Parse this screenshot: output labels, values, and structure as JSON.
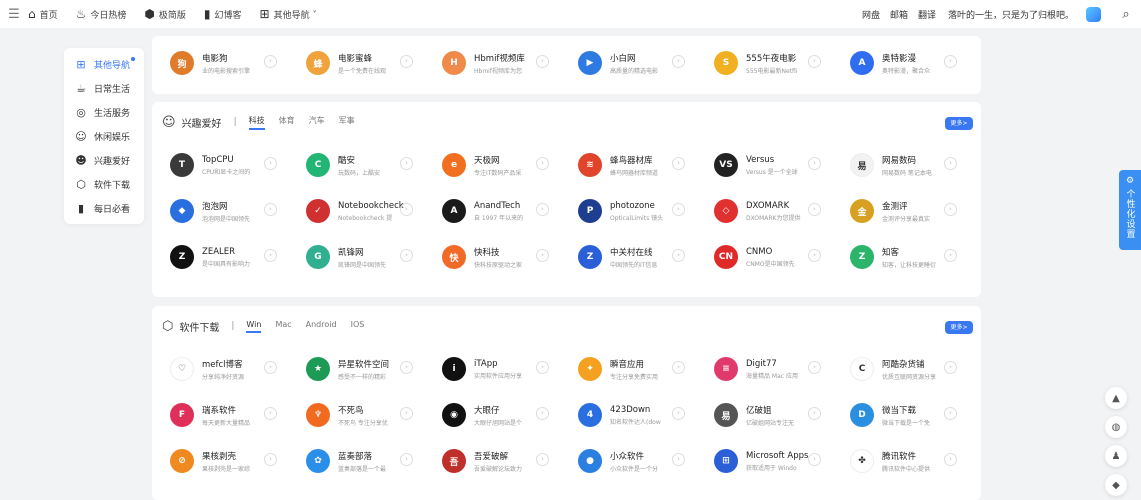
{
  "nav": {
    "menu_icon": "menu-icon",
    "items": [
      {
        "label": "首页",
        "icon": "home-icon",
        "glyph": "⌂"
      },
      {
        "label": "今日热榜",
        "icon": "fire-icon",
        "glyph": "♨"
      },
      {
        "label": "极简版",
        "icon": "cube-icon",
        "glyph": "⬢"
      },
      {
        "label": "幻博客",
        "icon": "notebook-icon",
        "glyph": "▮"
      },
      {
        "label": "其他导航",
        "icon": "grid-icon",
        "glyph": "⊞",
        "caret": "˅"
      }
    ],
    "right_links": [
      "网盘",
      "邮箱",
      "翻译"
    ],
    "motto": "落叶的一生，只是为了归根吧。",
    "search_icon": "search-icon"
  },
  "sidenav": {
    "items": [
      {
        "label": "其他导航",
        "icon": "grid-icon",
        "glyph": "⊞",
        "active": true
      },
      {
        "label": "日常生活",
        "icon": "cup-icon",
        "glyph": "☕"
      },
      {
        "label": "生活服务",
        "icon": "ring-icon",
        "glyph": "◎"
      },
      {
        "label": "休闲娱乐",
        "icon": "gamepad-icon",
        "glyph": "☺"
      },
      {
        "label": "兴趣爱好",
        "icon": "smile-icon",
        "glyph": "☻"
      },
      {
        "label": "软件下载",
        "icon": "cube-icon",
        "glyph": "⬡"
      },
      {
        "label": "每日必看",
        "icon": "book-icon",
        "glyph": "▮"
      }
    ]
  },
  "cards": [
    {
      "name": "top",
      "title": "",
      "tabs": [],
      "more": "",
      "sites": [
        {
          "name": "电影狗",
          "desc": "业的电影搜索引擎",
          "color": "#e07b2a",
          "letter": "狗"
        },
        {
          "name": "电影蜜蜂",
          "desc": "是一个免费在线观",
          "color": "#f0a23c",
          "letter": "蜂"
        },
        {
          "name": "Hbmif视频库",
          "desc": "Hbmif视频库为您",
          "color": "#f08a4b",
          "letter": "H"
        },
        {
          "name": "小白网",
          "desc": "高质量的精选电影",
          "color": "#2d7be0",
          "letter": "▶"
        },
        {
          "name": "555午夜电影",
          "desc": "555电影最新Netfli",
          "color": "#f0b020",
          "letter": "S"
        },
        {
          "name": "奥特影漫",
          "desc": "奥特影漫，聚合众",
          "color": "#2f6df0",
          "letter": "A"
        }
      ]
    },
    {
      "name": "interest",
      "title": "兴趣爱好",
      "tabs": [
        "科技",
        "体育",
        "汽车",
        "军事"
      ],
      "more": "更多>",
      "sites": [
        {
          "name": "TopCPU",
          "desc": "CPU和显卡之间的",
          "color": "#3a3a3a",
          "letter": "T"
        },
        {
          "name": "酷安",
          "desc": "玩数码，上酷安",
          "color": "#22b573",
          "letter": "C"
        },
        {
          "name": "天极网",
          "desc": "专注IT数码产品采",
          "color": "#f07020",
          "letter": "e"
        },
        {
          "name": "蜂鸟器材库",
          "desc": "蜂鸟网器材库频道",
          "color": "#e0442a",
          "letter": "≋"
        },
        {
          "name": "Versus",
          "desc": "Versus 是一个全球",
          "color": "#222222",
          "letter": "VS"
        },
        {
          "name": "网易数码",
          "desc": "网易数码 笔记本电",
          "color": "#f2f2f2",
          "letter": "易"
        },
        {
          "name": "泡泡网",
          "desc": "泡泡网是中国领先",
          "color": "#2a6fe0",
          "letter": "◆"
        },
        {
          "name": "Notebookcheck",
          "desc": "Notebookcheck 提",
          "color": "#d03030",
          "letter": "✓"
        },
        {
          "name": "AnandTech",
          "desc": "自 1997 年以来的",
          "color": "#1a1a1a",
          "letter": "A"
        },
        {
          "name": "photozone",
          "desc": "OpticalLimits 镜头",
          "color": "#1e3f8f",
          "letter": "P"
        },
        {
          "name": "DXOMARK",
          "desc": "DXOMARK为您提供",
          "color": "#e03030",
          "letter": "◇"
        },
        {
          "name": "金测评",
          "desc": "金测评分享最真实",
          "color": "#d8a020",
          "letter": "金"
        },
        {
          "name": "ZEALER",
          "desc": "是中国具有影响力",
          "color": "#111111",
          "letter": "Z"
        },
        {
          "name": "凯锋网",
          "desc": "凯锋网是中国领先",
          "color": "#30b090",
          "letter": "G"
        },
        {
          "name": "快科技",
          "desc": "快科技原驱动之家",
          "color": "#f06a28",
          "letter": "快"
        },
        {
          "name": "中关村在线",
          "desc": "中国领先的IT信息",
          "color": "#2a5fd8",
          "letter": "Z"
        },
        {
          "name": "CNMO",
          "desc": "CNMO是中国领先",
          "color": "#e02a2a",
          "letter": "CN"
        },
        {
          "name": "知客",
          "desc": "知客，让科技更睡衍",
          "color": "#2bb56a",
          "letter": "Z"
        }
      ]
    },
    {
      "name": "software",
      "title": "软件下载",
      "tabs": [
        "Win",
        "Mac",
        "Android",
        "IOS"
      ],
      "more": "更多>",
      "sites": [
        {
          "name": "mefcl博客",
          "desc": "分享纯净好资源",
          "color": "#ffffff",
          "letter": "♡"
        },
        {
          "name": "异星软件空间",
          "desc": "感受不一样的精彩",
          "color": "#1d9a56",
          "letter": "★"
        },
        {
          "name": "iTApp",
          "desc": "实用软件应用分享",
          "color": "#111111",
          "letter": "i"
        },
        {
          "name": "瞬音应用",
          "desc": "专注分享免费实用",
          "color": "#f4a020",
          "letter": "✦"
        },
        {
          "name": "Digit77",
          "desc": "海量精品 Mac 应用",
          "color": "#e03a6a",
          "letter": "≡"
        },
        {
          "name": "阿酷杂货铺",
          "desc": "优质互联网资源分享",
          "color": "#ffffff",
          "letter": "C"
        },
        {
          "name": "瑞系软件",
          "desc": "每天更新大量精品",
          "color": "#e0305a",
          "letter": "F"
        },
        {
          "name": "不死鸟",
          "desc": "不死鸟 专注分享优",
          "color": "#f06a20",
          "letter": "♆"
        },
        {
          "name": "大眼仔",
          "desc": "大眼仔旭网站是个",
          "color": "#111111",
          "letter": "◉"
        },
        {
          "name": "423Down",
          "desc": "知名软件达人(dow",
          "color": "#2a6fe0",
          "letter": "4"
        },
        {
          "name": "亿破姐",
          "desc": "亿破姐网站专注无",
          "color": "#555555",
          "letter": "易"
        },
        {
          "name": "微当下载",
          "desc": "微当下载是一个免",
          "color": "#2a8fe0",
          "letter": "D"
        },
        {
          "name": "果核剥壳",
          "desc": "果核剥壳是一家综",
          "color": "#f08a20",
          "letter": "⊘"
        },
        {
          "name": "蓝奏部落",
          "desc": "蓝奏部落是一个最",
          "color": "#2a8fe8",
          "letter": "✿"
        },
        {
          "name": "吾爱破解",
          "desc": "吾爱破解论坛致力",
          "color": "#c0302a",
          "letter": "吾"
        },
        {
          "name": "小众软件",
          "desc": "小众软件是一个分",
          "color": "#2a7fe0",
          "letter": "●"
        },
        {
          "name": "Microsoft Apps",
          "desc": "获取适用于 Windo",
          "color": "#2a5fd8",
          "letter": "⊞"
        },
        {
          "name": "腾讯软件",
          "desc": "腾讯软件中心提供",
          "color": "#ffffff",
          "letter": "✤"
        }
      ]
    }
  ],
  "settings_tab": {
    "label": "个性化设置",
    "icon": "gear-icon"
  },
  "float_buttons": [
    {
      "icon": "arrow-up-icon",
      "glyph": "▲"
    },
    {
      "icon": "wechat-icon",
      "glyph": "◍"
    },
    {
      "icon": "qq-icon",
      "glyph": "♟"
    },
    {
      "icon": "tag-icon",
      "glyph": "◆"
    }
  ]
}
